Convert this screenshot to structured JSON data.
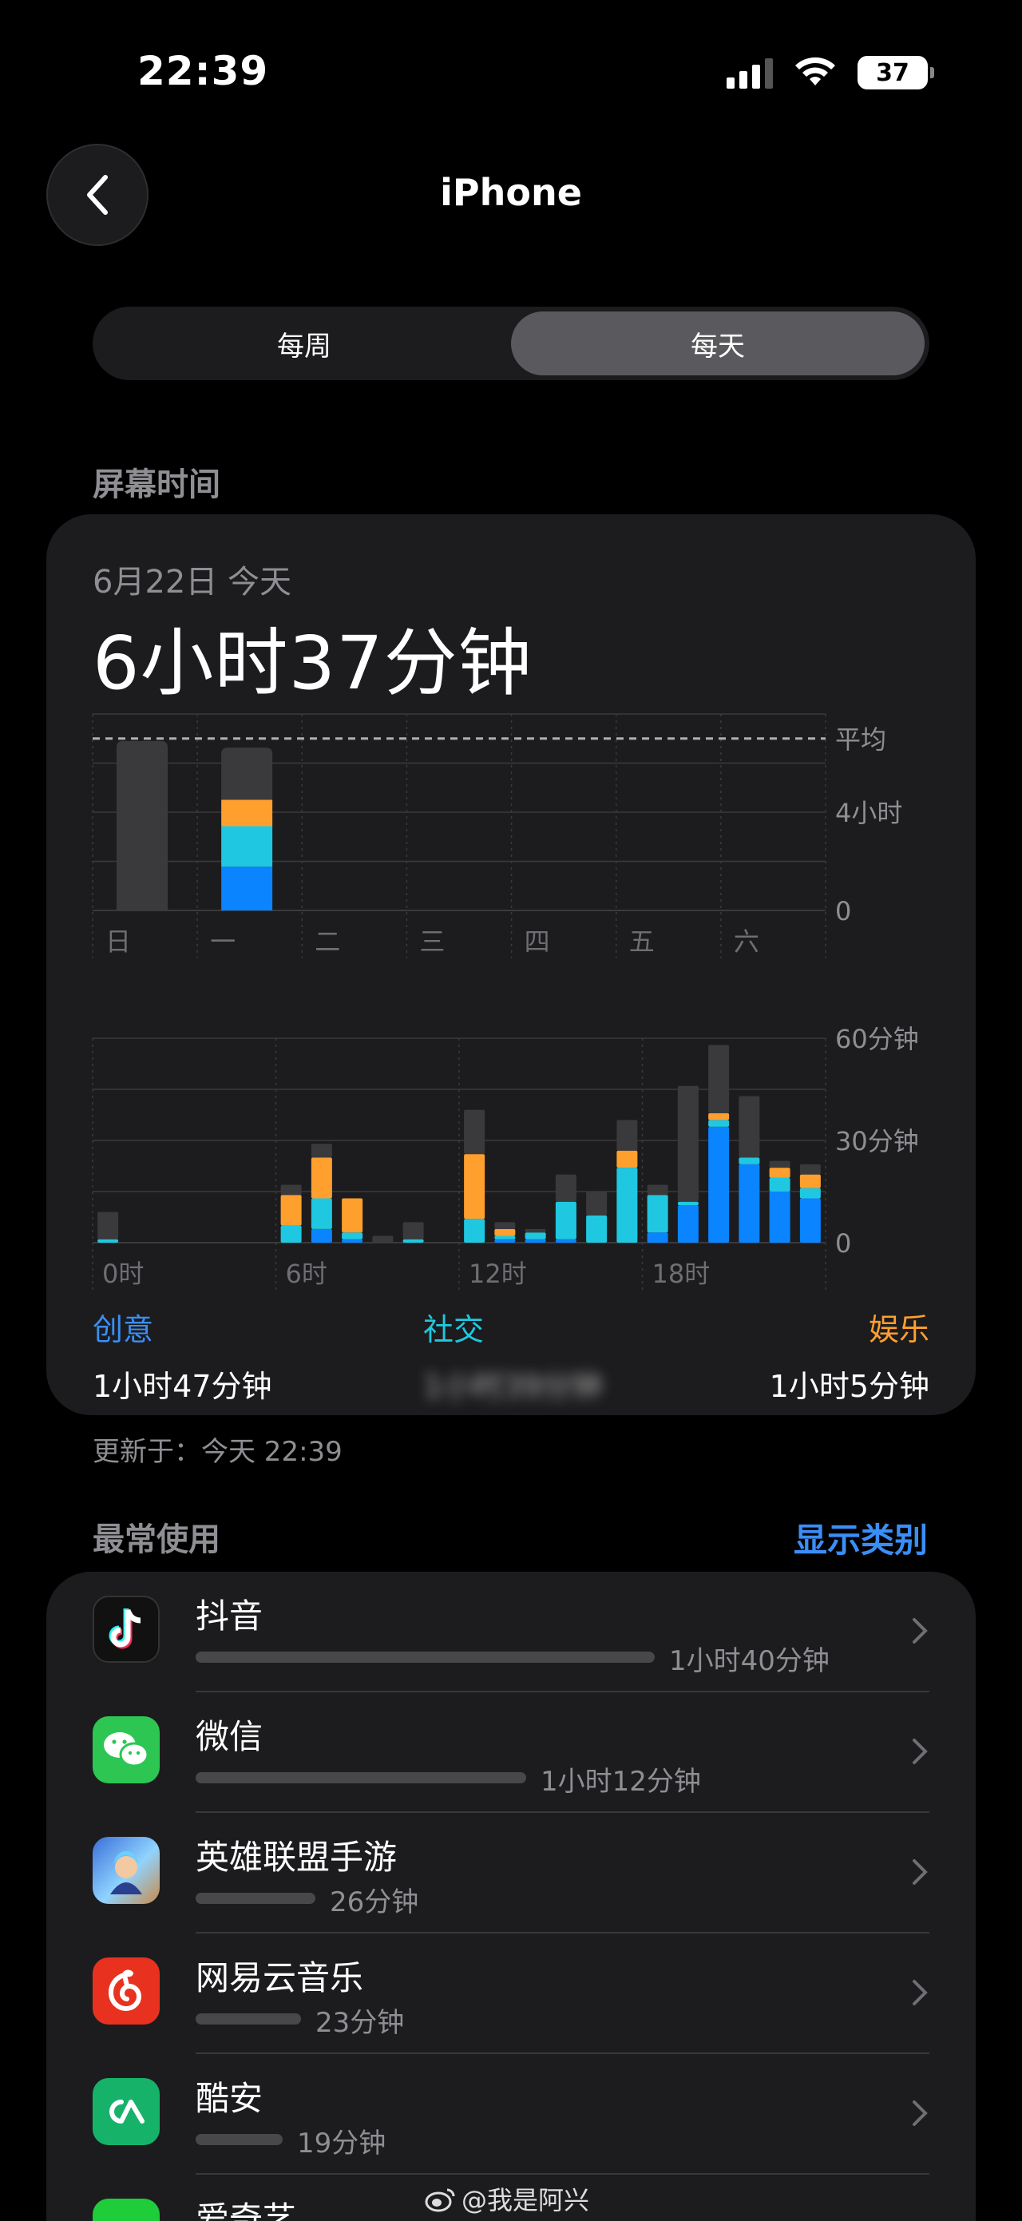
{
  "status_bar": {
    "time": "22:39",
    "battery": "37"
  },
  "header": {
    "title": "iPhone"
  },
  "segments": [
    {
      "label": "每周",
      "active": false
    },
    {
      "label": "每天",
      "active": true
    }
  ],
  "screen_time": {
    "section_title": "屏幕时间",
    "date": "6月22日 今天",
    "total": "6小时37分钟",
    "updated": "更新于：今天 22:39"
  },
  "chart_data": [
    {
      "type": "bar",
      "stacked": true,
      "categories": [
        "日",
        "一",
        "二",
        "三",
        "四",
        "五",
        "六"
      ],
      "y_tick_labels": [
        "0",
        "4小时"
      ],
      "ylim_hours": [
        0,
        8
      ],
      "average_label": "平均",
      "average_hours": 7.0,
      "series": [
        {
          "name": "创意",
          "color": "#0a84ff",
          "values": [
            0,
            1.78,
            0,
            0,
            0,
            0,
            0
          ]
        },
        {
          "name": "社交",
          "color": "#1fc8e0",
          "values": [
            0,
            1.65,
            0,
            0,
            0,
            0,
            0
          ]
        },
        {
          "name": "娱乐",
          "color": "#ff9f2e",
          "values": [
            0,
            1.08,
            0,
            0,
            0,
            0,
            0
          ]
        },
        {
          "name": "",
          "color": "#3a3a3c",
          "values": [
            6.9,
            2.12,
            0,
            0,
            0,
            0,
            0
          ]
        }
      ]
    },
    {
      "type": "bar",
      "stacked": true,
      "categories": [
        "0",
        "1",
        "2",
        "3",
        "4",
        "5",
        "6",
        "7",
        "8",
        "9",
        "10",
        "11",
        "12",
        "13",
        "14",
        "15",
        "16",
        "17",
        "18",
        "19",
        "20",
        "21",
        "22",
        "23"
      ],
      "x_tick_labels": [
        "0时",
        "6时",
        "12时",
        "18时"
      ],
      "y_tick_labels": [
        "0",
        "30分钟",
        "60分钟"
      ],
      "ylim_minutes": [
        0,
        60
      ],
      "series": [
        {
          "name": "创意",
          "color": "#0a84ff",
          "values": [
            0,
            0,
            0,
            0,
            0,
            0,
            0,
            4,
            1,
            0,
            0,
            0,
            0,
            1,
            1,
            1,
            0,
            0,
            3,
            11,
            34,
            23,
            15,
            13
          ]
        },
        {
          "name": "社交",
          "color": "#1fc8e0",
          "values": [
            1,
            0,
            0,
            0,
            0,
            0,
            5,
            9,
            2,
            0,
            1,
            0,
            7,
            1,
            2,
            11,
            8,
            22,
            11,
            1,
            2,
            2,
            4,
            3
          ]
        },
        {
          "name": "娱乐",
          "color": "#ff9f2e",
          "values": [
            0,
            0,
            0,
            0,
            0,
            0,
            9,
            12,
            10,
            0,
            0,
            0,
            19,
            2,
            0,
            0,
            0,
            5,
            0,
            0,
            2,
            0,
            3,
            4
          ]
        },
        {
          "name": "",
          "color": "#3a3a3c",
          "values": [
            8,
            0,
            0,
            0,
            0,
            0,
            3,
            4,
            0,
            2,
            5,
            0,
            13,
            2,
            1,
            8,
            7,
            9,
            3,
            34,
            20,
            18,
            2,
            3
          ]
        }
      ]
    }
  ],
  "categories_summary": [
    {
      "label": "创意",
      "value": "1小时47分钟",
      "color": "#3a8ef6"
    },
    {
      "label": "社交",
      "value": "1小时39分钟",
      "color": "#1fc8e0"
    },
    {
      "label": "娱乐",
      "value": "1小时5分钟",
      "color": "#ff9f2e"
    }
  ],
  "most_used": {
    "title": "最常使用",
    "show_categories": "显示类别",
    "apps": [
      {
        "name": "抖音",
        "time": "1小时40分钟",
        "fraction": 1.0,
        "icon": "douyin-icon"
      },
      {
        "name": "微信",
        "time": "1小时12分钟",
        "fraction": 0.72,
        "icon": "wechat-icon"
      },
      {
        "name": "英雄联盟手游",
        "time": "26分钟",
        "fraction": 0.26,
        "icon": "lol-icon"
      },
      {
        "name": "网易云音乐",
        "time": "23分钟",
        "fraction": 0.23,
        "icon": "netease-music-icon"
      },
      {
        "name": "酷安",
        "time": "19分钟",
        "fraction": 0.19,
        "icon": "coolapk-icon"
      },
      {
        "name": "爱奇艺",
        "time": "",
        "fraction": 0.15,
        "icon": "iqiyi-icon"
      }
    ]
  },
  "watermark": "@我是阿兴"
}
